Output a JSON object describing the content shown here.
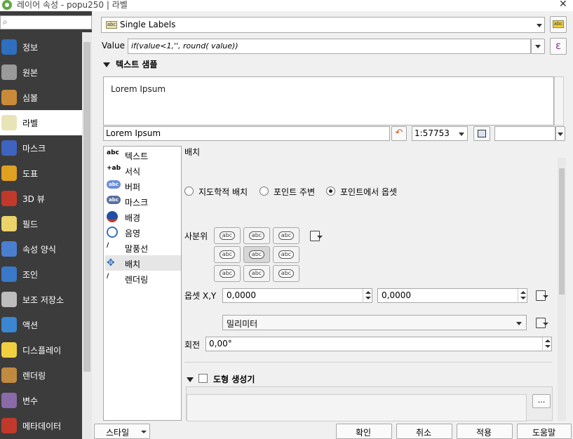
{
  "window": {
    "title": "레이어 속성 - popu250 | 라벨",
    "close_glyph": "✕"
  },
  "nav": {
    "search_glyph": "⌕",
    "items": [
      {
        "label": "정보",
        "icon": "info-icon",
        "color": "#2f6fbf"
      },
      {
        "label": "원본",
        "icon": "source-icon",
        "color": "#9a9a9a"
      },
      {
        "label": "심볼",
        "icon": "symbology-icon",
        "color": "#c98a3a"
      },
      {
        "label": "라벨",
        "icon": "labels-icon",
        "color": "#e9e3b8"
      },
      {
        "label": "마스크",
        "icon": "mask-icon",
        "color": "#3e63c0"
      },
      {
        "label": "도표",
        "icon": "diagram-icon",
        "color": "#e0a020"
      },
      {
        "label": "3D 뷰",
        "icon": "3d-view-icon",
        "color": "#c0392b"
      },
      {
        "label": "필드",
        "icon": "fields-icon",
        "color": "#e9d36a"
      },
      {
        "label": "속성 양식",
        "icon": "attributes-form-icon",
        "color": "#4a7fd0"
      },
      {
        "label": "조인",
        "icon": "join-icon",
        "color": "#3a78c8"
      },
      {
        "label": "보조 저장소",
        "icon": "auxiliary-storage-icon",
        "color": "#bdbdbd"
      },
      {
        "label": "액션",
        "icon": "actions-icon",
        "color": "#3a86d0"
      },
      {
        "label": "디스플레이",
        "icon": "display-icon",
        "color": "#f0d040"
      },
      {
        "label": "렌더링",
        "icon": "rendering-icon",
        "color": "#c08a40"
      },
      {
        "label": "변수",
        "icon": "variables-icon",
        "color": "#8a6aa8"
      },
      {
        "label": "메타데이터",
        "icon": "metadata-icon",
        "color": "#c0392b"
      }
    ]
  },
  "mode_combo": {
    "value": "Single Labels",
    "badge": "abc"
  },
  "value_row": {
    "label": "Value",
    "expression": "if(value<1,'', round( value))",
    "epsilon": "ε"
  },
  "text_sample": {
    "heading": "텍스트 샘플",
    "preview": "Lorem Ipsum",
    "input_value": "Lorem Ipsum",
    "scale": "1:57753",
    "extra_value": ""
  },
  "sub_tabs": [
    {
      "label": "텍스트",
      "icon": "text-icon"
    },
    {
      "label": "서식",
      "icon": "formatting-icon"
    },
    {
      "label": "버퍼",
      "icon": "buffer-icon"
    },
    {
      "label": "마스크",
      "icon": "mask-icon"
    },
    {
      "label": "배경",
      "icon": "background-icon"
    },
    {
      "label": "음영",
      "icon": "shadow-icon"
    },
    {
      "label": "말풍선",
      "icon": "callouts-icon"
    },
    {
      "label": "배치",
      "icon": "placement-icon"
    },
    {
      "label": "렌더링",
      "icon": "rendering-icon"
    }
  ],
  "placement": {
    "heading": "배치",
    "radio_options": [
      {
        "label": "지도학적 배치",
        "checked": false
      },
      {
        "label": "포인트 주변",
        "checked": false
      },
      {
        "label": "포인트에서 옵셋",
        "checked": true
      }
    ],
    "quadrant_label": "사분위",
    "quadrant_text": "abc",
    "offset_label": "옵셋 X,Y",
    "offset_x": "0,0000",
    "offset_y": "0,0000",
    "unit": "밀리미터",
    "rotation_label": "회전",
    "rotation": "0,00°",
    "geometry_generator": {
      "label": "도형 생성기",
      "checked": false,
      "ellipsis": "..."
    }
  },
  "footer": {
    "style_button": "스타일",
    "ok": "확인",
    "cancel": "취소",
    "apply": "적용",
    "help": "도움말"
  }
}
